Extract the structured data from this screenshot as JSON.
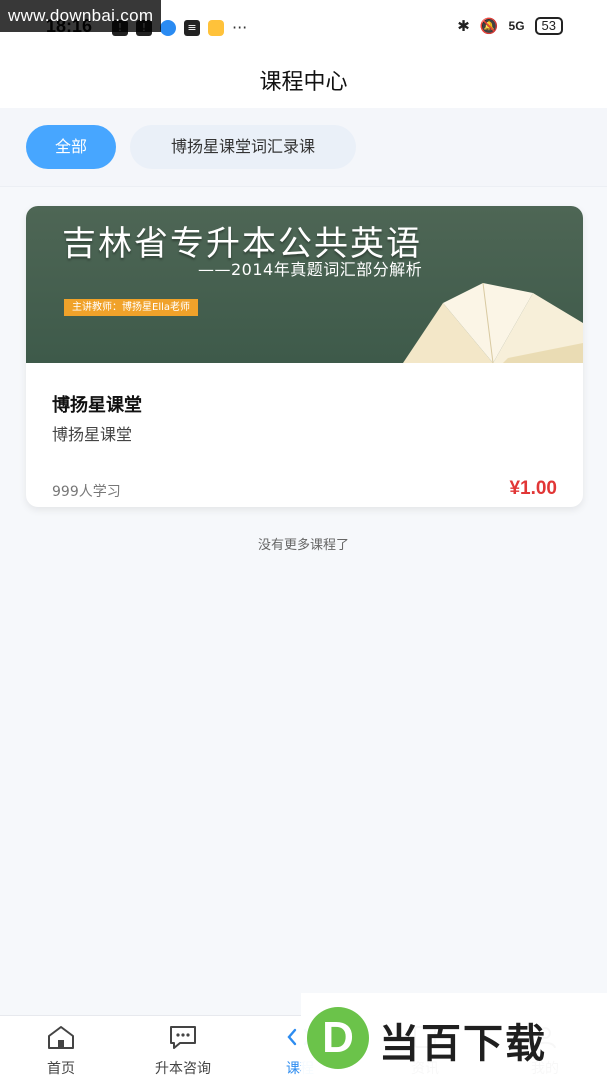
{
  "watermark_top": "www.downbai.com",
  "status_bar": {
    "time": "18:16",
    "network": "5G",
    "battery": "53"
  },
  "header": {
    "title": "课程中心"
  },
  "tabs": [
    {
      "label": "全部",
      "active": true
    },
    {
      "label": "博扬星课堂词汇录课",
      "active": false
    }
  ],
  "course": {
    "banner_title": "吉林省专升本公共英语",
    "banner_subtitle": "——2014年真题词汇部分解析",
    "banner_tag": "主讲教师：博扬星Ella老师",
    "name": "博扬星课堂",
    "organization": "博扬星课堂",
    "learners": "999人学习",
    "price": "¥1.00"
  },
  "no_more": "没有更多课程了",
  "bottom_nav": [
    {
      "label": "首页",
      "icon": "home-icon"
    },
    {
      "label": "升本咨询",
      "icon": "chat-icon"
    },
    {
      "label": "课程",
      "icon": "course-icon",
      "active": true
    },
    {
      "label": "资讯",
      "icon": "news-icon"
    },
    {
      "label": "我的",
      "icon": "user-icon"
    }
  ],
  "logo_watermark": {
    "letter": "D",
    "text": "当百下载"
  },
  "colors": {
    "accent": "#47a6ff",
    "price": "#e13636",
    "banner": "#4e6655"
  }
}
